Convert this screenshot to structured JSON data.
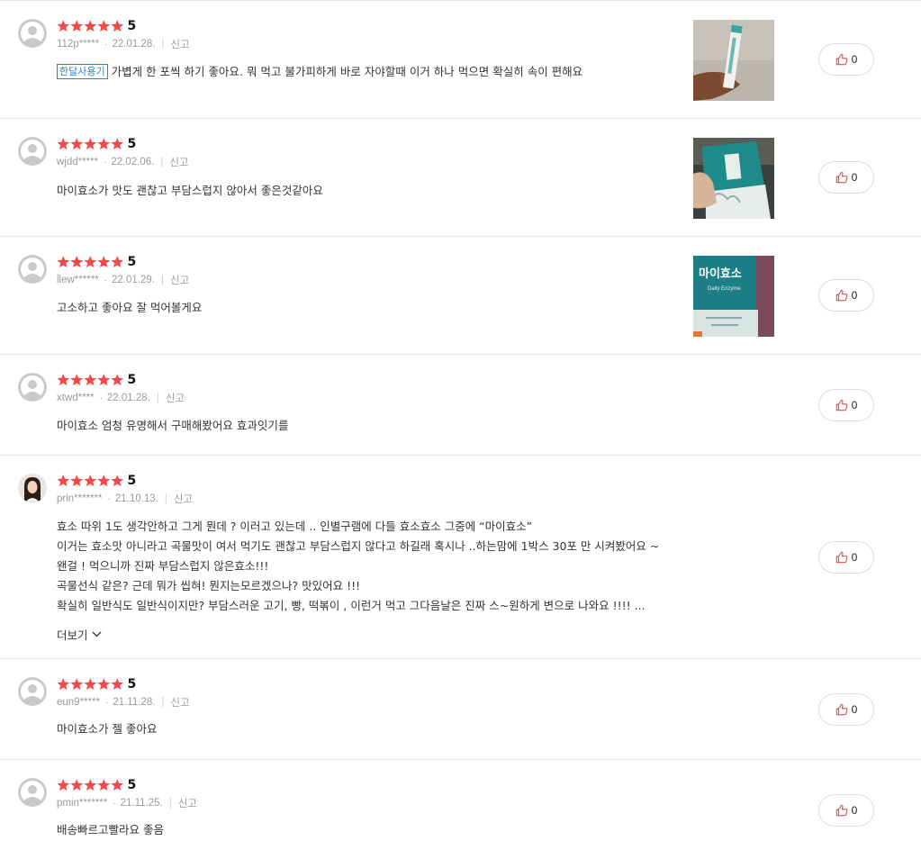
{
  "colors": {
    "star": "#f24a4a",
    "badge": "#2d7fd3",
    "like_icon": "#e05252"
  },
  "icons": {
    "star": "star-icon",
    "thumbs_up": "thumbs-up-icon",
    "chevron": "chevron-down-icon",
    "avatar": "default-avatar-icon"
  },
  "reviews": [
    {
      "rating": 5,
      "score": "5",
      "user": "112p*****",
      "date": "22.01.28.",
      "report": "신고",
      "badge": "한달사용기",
      "lines": [
        "가볍게 한 포씩 하기 좋아요. 뭐 먹고 불가피하게 바로 자야할때 이거 하나 먹으면 확실히 속이 편해요"
      ],
      "likes": "0"
    },
    {
      "rating": 5,
      "score": "5",
      "user": "wjdd*****",
      "date": "22.02.06.",
      "report": "신고",
      "lines": [
        "마이효소가 맛도 괜찮고 부담스럽지 않아서 좋은것같아요"
      ],
      "likes": "0"
    },
    {
      "rating": 5,
      "score": "5",
      "user": "llew******",
      "date": "22.01.29.",
      "report": "신고",
      "lines": [
        "고소하고 좋아요 잘 먹어볼게요"
      ],
      "likes": "0",
      "image_text": {
        "brand": "마이효소",
        "sub": "Daily Enzyme"
      }
    },
    {
      "rating": 5,
      "score": "5",
      "user": "xtwd****",
      "date": "22.01.28.",
      "report": "신고",
      "lines": [
        "마이효소 엄청 유명해서 구매해봤어요 효과잇기를"
      ],
      "likes": "0"
    },
    {
      "rating": 5,
      "score": "5",
      "user": "prin*******",
      "date": "21.10.13.",
      "report": "신고",
      "lines": [
        "효소 따위 1도 생각안하고 그게 뭔데 ? 이러고 있는데 .. 인별구램에 다들 효소효소 그중에 “마이효소”",
        "이거는 효소맛 아니라고 곡물맛이 여서 먹기도 괜찮고 부담스럽지 않다고 하길래 혹시나 ..하는맘에 1박스 30포 만 시켜봤어요 ~",
        "왠걸 ! 먹으니까 진짜 부담스럽지 않은효소!!!",
        "곡물선식 같은? 근데 뭐가 씹혀! 뭔지는모르겠으나? 맛있어요 !!!",
        "확실히 일반식도 일반식이지만? 부담스러운 고기, 빵, 떡볶이 , 이런거 먹고 그다음날은 진짜 스~원하게 변으로 나와요 !!!! ..."
      ],
      "more": "더보기",
      "likes": "0"
    },
    {
      "rating": 5,
      "score": "5",
      "user": "eun9*****",
      "date": "21.11.28.",
      "report": "신고",
      "lines": [
        "마이효소가 젤 좋아요"
      ],
      "likes": "0"
    },
    {
      "rating": 5,
      "score": "5",
      "user": "pmin*******",
      "date": "21.11.25.",
      "report": "신고",
      "lines": [
        "배송빠르고빨라요 좋음"
      ],
      "likes": "0"
    }
  ]
}
